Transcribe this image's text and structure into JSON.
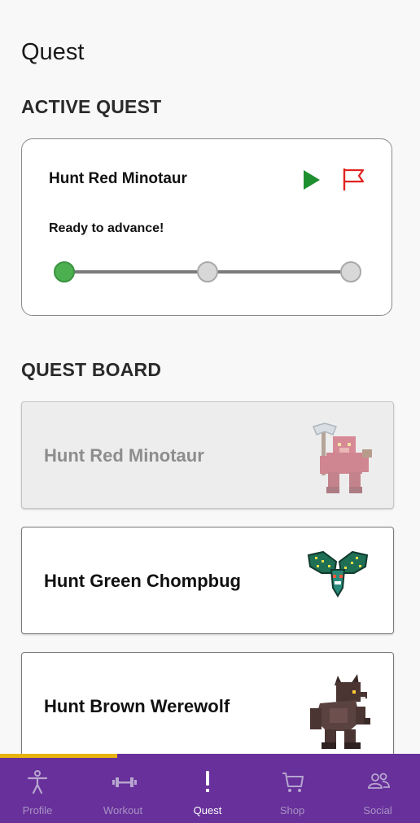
{
  "page": {
    "title": "Quest"
  },
  "active_quest": {
    "section_title": "ACTIVE QUEST",
    "quest_name": "Hunt Red Minotaur",
    "status": "Ready to advance!",
    "progress": {
      "steps": 3,
      "completed": 1
    },
    "play_icon": "play-icon",
    "flag_icon": "flag-icon"
  },
  "quest_board": {
    "section_title": "QUEST BOARD",
    "items": [
      {
        "label": "Hunt Red Minotaur",
        "monster_icon": "red-minotaur-icon",
        "disabled": true
      },
      {
        "label": "Hunt Green Chompbug",
        "monster_icon": "green-chompbug-icon",
        "disabled": false
      },
      {
        "label": "Hunt Brown Werewolf",
        "monster_icon": "brown-werewolf-icon",
        "disabled": false
      }
    ]
  },
  "bottom_nav": {
    "items": [
      {
        "label": "Profile",
        "icon": "person-icon",
        "selected": false
      },
      {
        "label": "Workout",
        "icon": "dumbbell-icon",
        "selected": false
      },
      {
        "label": "Quest",
        "icon": "exclamation-icon",
        "selected": true
      },
      {
        "label": "Shop",
        "icon": "cart-icon",
        "selected": false
      },
      {
        "label": "Social",
        "icon": "people-icon",
        "selected": false
      }
    ]
  },
  "colors": {
    "background": "#f8f8f8",
    "nav_background": "#67309a",
    "nav_indicator": "#e8b30f",
    "play": "#1e8f2f",
    "flag": "#e0231f",
    "progress_active": "#4caf50"
  }
}
